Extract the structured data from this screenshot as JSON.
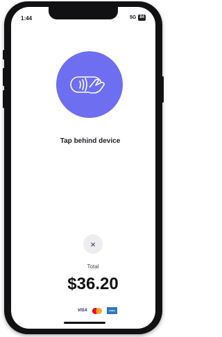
{
  "status_bar": {
    "time": "1:44",
    "network": "5G",
    "battery": "84"
  },
  "main": {
    "prompt": "Tap behind device"
  },
  "payment": {
    "total_label": "Total",
    "amount": "$36.20",
    "cancel_icon": "×"
  },
  "cards": {
    "visa_label": "VISA",
    "amex_label": "AMEX"
  },
  "colors": {
    "accent": "#6e6ef0",
    "mastercard_red": "#eb001b",
    "mastercard_orange": "#f79e1b",
    "amex_blue": "#2e77bc"
  },
  "icons": {
    "tap": "contactless-tap-icon",
    "close": "close-icon"
  }
}
